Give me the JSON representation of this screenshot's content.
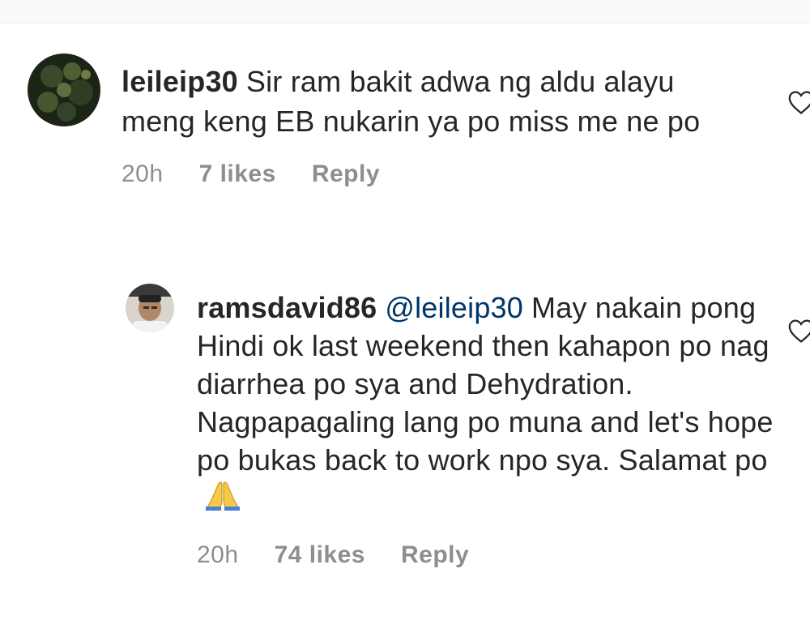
{
  "comments": [
    {
      "username": "leileip30",
      "text": "Sir ram bakit adwa ng aldu alayu meng keng EB nukarin ya po miss me ne po",
      "time": "20h",
      "likes": "7 likes",
      "reply_label": "Reply",
      "avatar_icon": "profile-photo-foliage",
      "like_icon": "heart-outline-icon"
    },
    {
      "username": "ramsdavid86",
      "mention": "@leileip30",
      "text": "May nakain pong Hindi ok last weekend then kahapon po nag diarrhea po sya and Dehydration. Nagpapagaling lang po muna and let's hope po bukas back to work npo sya. Salamat po",
      "emoji": "folded-hands-icon",
      "time": "20h",
      "likes": "74 likes",
      "reply_label": "Reply",
      "avatar_icon": "profile-photo-person",
      "like_icon": "heart-outline-icon"
    }
  ],
  "colors": {
    "text": "#262626",
    "meta": "#8e8e8e",
    "mention": "#003569"
  }
}
